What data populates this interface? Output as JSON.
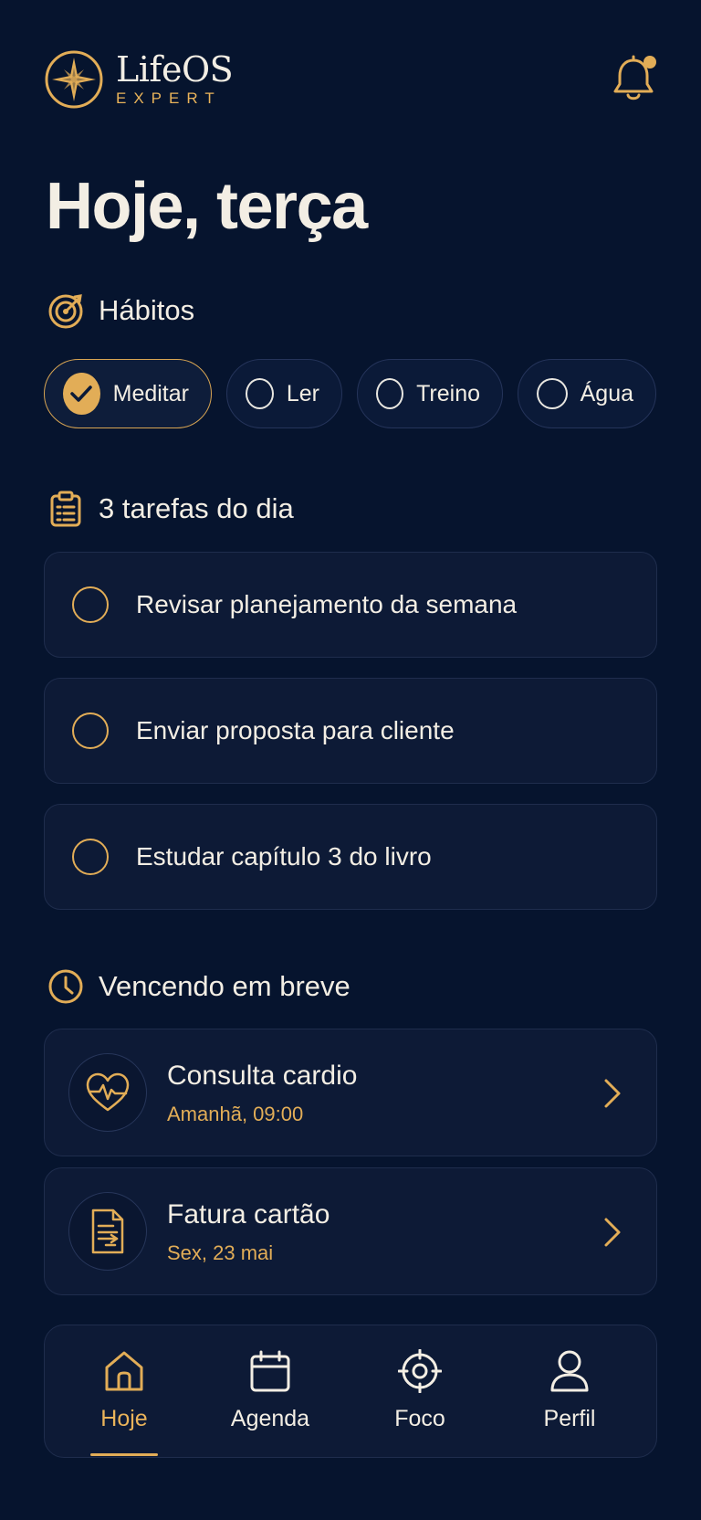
{
  "app": {
    "name": "LifeOS",
    "tagline": "EXPERT"
  },
  "page_title": "Hoje, terça",
  "habits": {
    "heading": "Hábitos",
    "items": [
      {
        "label": "Meditar",
        "done": true
      },
      {
        "label": "Ler",
        "done": false
      },
      {
        "label": "Treino",
        "done": false
      },
      {
        "label": "Água",
        "done": false
      }
    ]
  },
  "tasks": {
    "heading": "3 tarefas do dia",
    "items": [
      {
        "label": "Revisar planejamento da semana",
        "done": false
      },
      {
        "label": "Enviar proposta para cliente",
        "done": false
      },
      {
        "label": "Estudar capítulo 3 do livro",
        "done": false
      }
    ]
  },
  "upcoming": {
    "heading": "Vencendo em breve",
    "items": [
      {
        "title": "Consulta cardio",
        "when": "Amanhã, 09:00",
        "icon": "heart-pulse-icon"
      },
      {
        "title": "Fatura cartão",
        "when": "Sex, 23 mai",
        "icon": "invoice-icon"
      }
    ]
  },
  "nav": {
    "items": [
      {
        "label": "Hoje",
        "icon": "home-icon",
        "active": true
      },
      {
        "label": "Agenda",
        "icon": "calendar-icon",
        "active": false
      },
      {
        "label": "Foco",
        "icon": "target-icon",
        "active": false
      },
      {
        "label": "Perfil",
        "icon": "user-icon",
        "active": false
      }
    ]
  },
  "colors": {
    "background": "#06142e",
    "accent": "#e2ad57",
    "card": "#0d1a36",
    "text": "#f3eee4"
  }
}
